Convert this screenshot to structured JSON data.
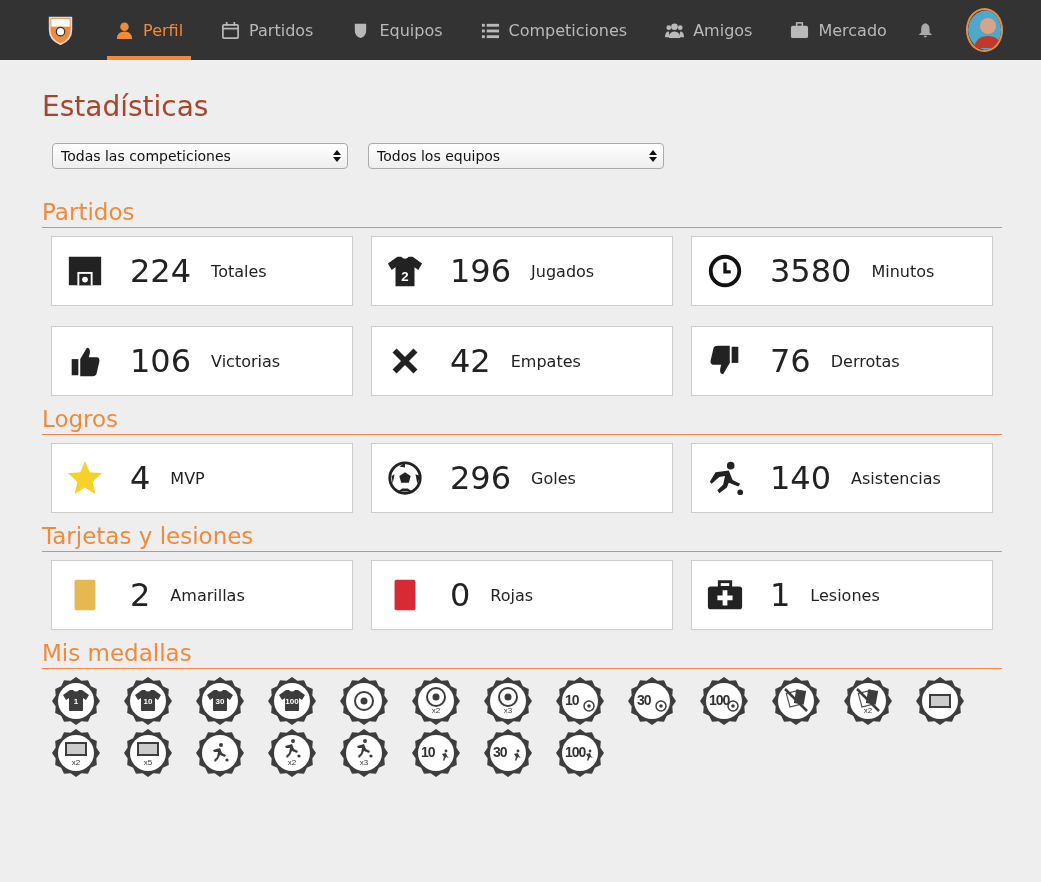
{
  "nav": {
    "items": [
      {
        "label": "Perfil",
        "kind": "user",
        "selected": true
      },
      {
        "label": "Partidos",
        "kind": "calendar",
        "selected": false
      },
      {
        "label": "Equipos",
        "kind": "shield",
        "selected": false
      },
      {
        "label": "Competiciones",
        "kind": "list",
        "selected": false
      },
      {
        "label": "Amigos",
        "kind": "users",
        "selected": false
      },
      {
        "label": "Mercado",
        "kind": "briefcase",
        "selected": false
      }
    ]
  },
  "title": "Estadísticas",
  "filters": [
    {
      "value": "Todas las competiciones"
    },
    {
      "value": "Todos los equipos"
    }
  ],
  "sections": [
    {
      "title": "Partidos",
      "stats": [
        {
          "kind": "pitch",
          "value": "224",
          "label": "Totales"
        },
        {
          "kind": "shirt",
          "value": "196",
          "label": "Jugados",
          "badge": "2"
        },
        {
          "kind": "clock",
          "value": "3580",
          "label": "Minutos"
        },
        {
          "kind": "thumbs-up",
          "value": "106",
          "label": "Victorias"
        },
        {
          "kind": "cross",
          "value": "42",
          "label": "Empates"
        },
        {
          "kind": "thumbs-down",
          "value": "76",
          "label": "Derrotas"
        }
      ]
    },
    {
      "title": "Logros",
      "stats": [
        {
          "kind": "star",
          "value": "4",
          "label": "MVP"
        },
        {
          "kind": "ball",
          "value": "296",
          "label": "Goles"
        },
        {
          "kind": "kicker",
          "value": "140",
          "label": "Asistencias"
        }
      ]
    },
    {
      "title": "Tarjetas y lesiones",
      "stats": [
        {
          "kind": "yellow-card",
          "value": "2",
          "label": "Amarillas"
        },
        {
          "kind": "red-card",
          "value": "0",
          "label": "Rojas"
        },
        {
          "kind": "medkit",
          "value": "1",
          "label": "Lesiones"
        }
      ]
    }
  ],
  "medals": {
    "title": "Mis medallas",
    "items": [
      {
        "kind": "shirt",
        "text": "1"
      },
      {
        "kind": "shirt",
        "text": "10"
      },
      {
        "kind": "shirt",
        "text": "30"
      },
      {
        "kind": "shirt",
        "text": "100"
      },
      {
        "kind": "ball"
      },
      {
        "kind": "ball",
        "sub": "x2"
      },
      {
        "kind": "ball",
        "sub": "x3"
      },
      {
        "kind": "goals",
        "text": "10"
      },
      {
        "kind": "goals",
        "text": "30"
      },
      {
        "kind": "goals",
        "text": "100"
      },
      {
        "kind": "no-card"
      },
      {
        "kind": "no-card",
        "sub": "x2"
      },
      {
        "kind": "goal"
      },
      {
        "kind": "goal",
        "sub": "x2"
      },
      {
        "kind": "goal",
        "sub": "x5"
      },
      {
        "kind": "kicker"
      },
      {
        "kind": "kicker",
        "sub": "x2"
      },
      {
        "kind": "kicker",
        "sub": "x3"
      },
      {
        "kind": "assists",
        "text": "10"
      },
      {
        "kind": "assists",
        "text": "30"
      },
      {
        "kind": "assists",
        "text": "100"
      }
    ]
  }
}
